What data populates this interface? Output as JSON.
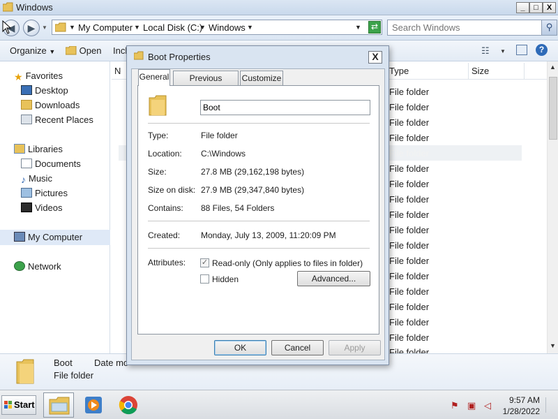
{
  "window": {
    "title": "Windows",
    "buttons": {
      "minimize": "_",
      "maximize": "□",
      "close": "X"
    }
  },
  "address": {
    "segments": [
      "My Computer",
      "Local Disk (C:)",
      "Windows"
    ],
    "search_placeholder": "Search Windows"
  },
  "toolbar": {
    "organize": "Organize",
    "open": "Open",
    "include": "Incl"
  },
  "columns": {
    "name": "N",
    "type": "Type",
    "size": "Size"
  },
  "nav": {
    "favorites": "Favorites",
    "favorites_items": [
      "Desktop",
      "Downloads",
      "Recent Places"
    ],
    "libraries": "Libraries",
    "libraries_items": [
      "Documents",
      "Music",
      "Pictures",
      "Videos"
    ],
    "computer": "My Computer",
    "network": "Network"
  },
  "files": {
    "types": [
      "File folder",
      "File folder",
      "File folder",
      "File folder",
      "File folder",
      "File folder",
      "File folder",
      "File folder",
      "File folder",
      "File folder",
      "File folder",
      "File folder",
      "File folder",
      "File folder",
      "File folder",
      "File folder",
      "File folder",
      "File folder"
    ],
    "partial_type": "File folder",
    "highlight_type": "File folder"
  },
  "details": {
    "name": "Boot",
    "date_label": "Date mo",
    "kind": "File folder"
  },
  "taskbar": {
    "start": "Start",
    "time": "9:57 AM",
    "date": "1/28/2022"
  },
  "dialog": {
    "title": "Boot Properties",
    "close": "X",
    "tabs": [
      "General",
      "Previous Versions",
      "Customize"
    ],
    "name_value": "Boot",
    "props": [
      {
        "label": "Type:",
        "value": "File folder"
      },
      {
        "label": "Location:",
        "value": "C:\\Windows"
      },
      {
        "label": "Size:",
        "value": "27.8 MB (29,162,198 bytes)"
      },
      {
        "label": "Size on disk:",
        "value": "27.9 MB (29,347,840 bytes)"
      },
      {
        "label": "Contains:",
        "value": "88 Files, 54 Folders"
      }
    ],
    "created_label": "Created:",
    "created_value": "Monday, July 13, 2009, 11:20:09 PM",
    "attributes_label": "Attributes:",
    "readonly_label": "Read-only (Only applies to files in folder)",
    "hidden_label": "Hidden",
    "advanced": "Advanced...",
    "ok": "OK",
    "cancel": "Cancel",
    "apply": "Apply"
  }
}
